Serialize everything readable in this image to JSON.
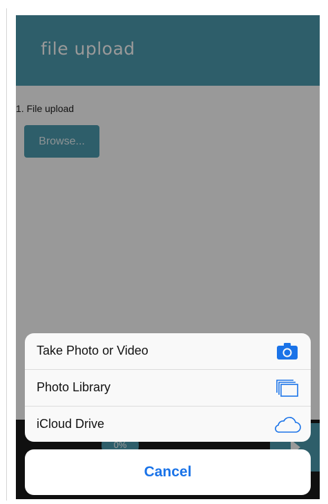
{
  "header": {
    "title": "file upload"
  },
  "form": {
    "field_label": "1. File upload",
    "browse_label": "Browse..."
  },
  "player": {
    "progress_text": "0%"
  },
  "action_sheet": {
    "items": [
      {
        "label": "Take Photo or Video",
        "icon": "camera-icon"
      },
      {
        "label": "Photo Library",
        "icon": "photo-library-icon"
      },
      {
        "label": "iCloud Drive",
        "icon": "cloud-icon"
      }
    ],
    "cancel_label": "Cancel"
  },
  "colors": {
    "header": "#4e9db1",
    "button": "#4e9db1",
    "ios_blue": "#1a73e8",
    "overlay": "rgba(0,0,0,0.40)"
  }
}
